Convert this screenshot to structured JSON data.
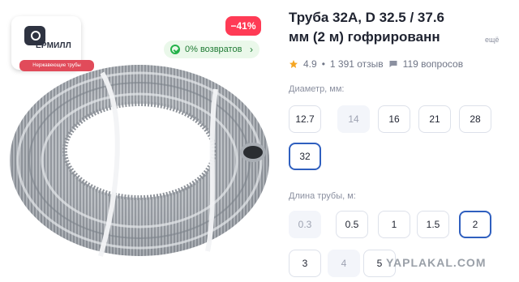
{
  "brand": {
    "name": "ЕРМИЛЛ",
    "tagline": "Нержавеющие трубы"
  },
  "badges": {
    "discount": "−41%",
    "returns": "0% возвратов"
  },
  "product": {
    "title_line1": "Труба 32А, D 32.5 / 37.6",
    "title_line2": "мм (2 м) гофрированн",
    "more_link": "ещё",
    "rating": "4.9",
    "reviews": "1 391 отзыв",
    "questions": "119 вопросов"
  },
  "diameter": {
    "label": "Диаметр, мм:",
    "options": [
      {
        "value": "12.7",
        "state": "normal"
      },
      {
        "value": "14",
        "state": "disabled"
      },
      {
        "value": "16",
        "state": "normal"
      },
      {
        "value": "21",
        "state": "normal"
      },
      {
        "value": "28",
        "state": "normal"
      },
      {
        "value": "32",
        "state": "selected"
      }
    ]
  },
  "length": {
    "label": "Длина трубы, м:",
    "options": [
      {
        "value": "0.3",
        "state": "disabled"
      },
      {
        "value": "0.5",
        "state": "normal"
      },
      {
        "value": "1",
        "state": "normal"
      },
      {
        "value": "1.5",
        "state": "normal"
      },
      {
        "value": "2",
        "state": "selected"
      },
      {
        "value": "3",
        "state": "normal"
      },
      {
        "value": "4",
        "state": "disabled"
      },
      {
        "value": "5",
        "state": "normal"
      }
    ]
  },
  "watermark": "YAPLAKAL.COM",
  "colors": {
    "accent": "#2f5fbf",
    "discount": "#ff3b55",
    "returns_bg": "#eaf8ea",
    "returns_text": "#1f7b34",
    "star": "#f5a623"
  },
  "icons": {
    "star": "star-icon",
    "questions": "chat-icon",
    "returns": "check-circle-icon"
  }
}
